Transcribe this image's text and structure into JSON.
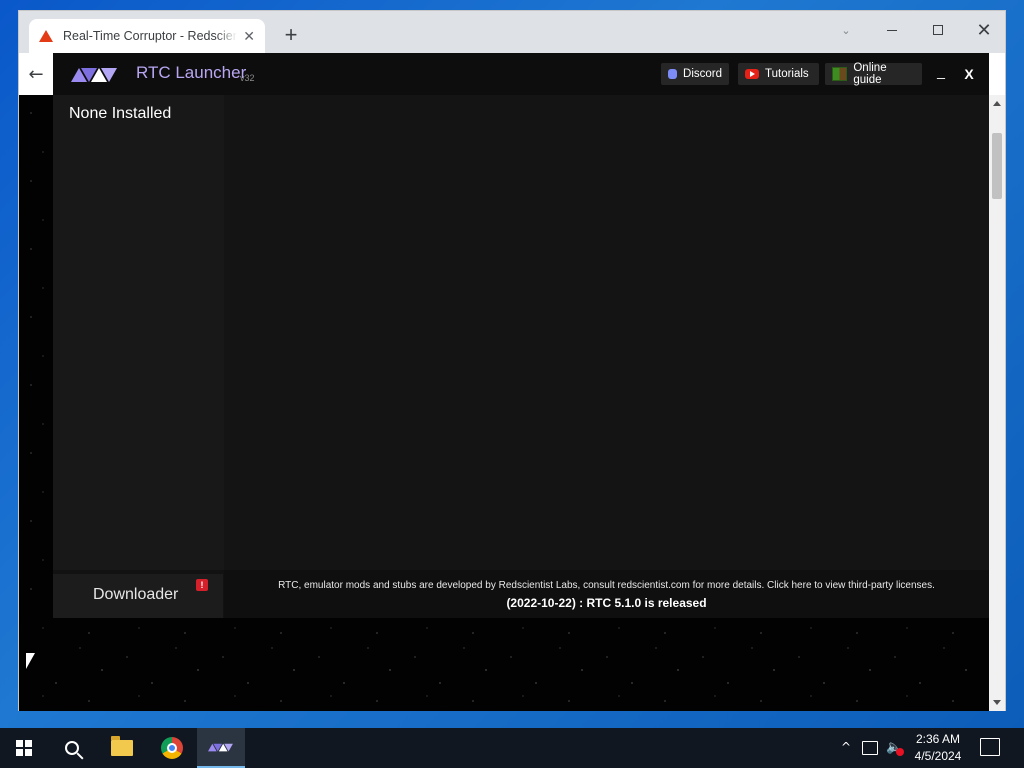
{
  "browser": {
    "tab_title": "Real-Time Corruptor - Redscientist Labs",
    "tab_close": "✕",
    "new_tab": "+",
    "tab_search": "⌄",
    "win_close": "✕",
    "back": "←"
  },
  "app": {
    "title": "RTC Launcher",
    "version": "v32",
    "buttons": {
      "discord": "Discord",
      "tutorials": "Tutorials",
      "online_guide": "Online guide"
    },
    "minimize": "_",
    "close": "X",
    "sidebar_title": "None Installed",
    "downloader": "Downloader",
    "downloader_alert": "!",
    "footer_credits": "RTC, emulator mods and stubs are developed by Redscientist Labs, consult redscientist.com for more details. Click here to view third-party licenses.",
    "footer_news": "(2022-10-22) : RTC 5.1.0 is released",
    "accent_color": "#b9a6f3"
  },
  "taskbar": {
    "items": [
      "start",
      "search",
      "file-explorer",
      "chrome",
      "rtc-launcher"
    ],
    "active": "rtc-launcher",
    "tray_chevron": "^",
    "volume": "🔈",
    "clock_time": "2:36 AM",
    "clock_date": "4/5/2024"
  }
}
